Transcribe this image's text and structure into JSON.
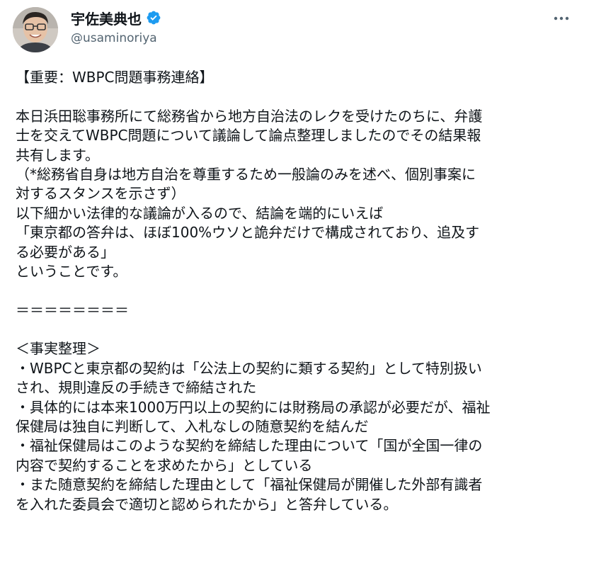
{
  "author": {
    "display_name": "宇佐美典也",
    "handle": "@usaminoriya",
    "verified": true,
    "avatar_icon": "person-avatar-icon"
  },
  "menu": {
    "icon": "more-horizontal-icon",
    "label": "···"
  },
  "colors": {
    "text": "#0f1419",
    "secondary_text": "#536471",
    "verified_badge": "#1d9bf0"
  },
  "tweet": {
    "lines": [
      "【重要：WBPC問題事務連絡】",
      "",
      "本日浜田聡事務所にて総務省から地方自治法のレクを受けたのちに、弁護",
      "士を交えてWBPC問題について議論して論点整理しましたのでその結果報",
      "共有します。",
      "（*総務省自身は地方自治を尊重するため一般論のみを述べ、個別事案に",
      "対するスタンスを示さず）",
      "以下細かい法律的な議論が入るので、結論を端的にいえば",
      "「東京都の答弁は、ほぼ100%ウソと詭弁だけで構成されており、追及す",
      "る必要がある」",
      "ということです。",
      "",
      "＝＝＝＝＝＝＝＝",
      "",
      "＜事実整理＞",
      "・WBPCと東京都の契約は「公法上の契約に類する契約」として特別扱い",
      "され、規則違反の手続きで締結された",
      "・具体的には本来1000万円以上の契約には財務局の承認が必要だが、福祉",
      "保健局は独自に判断して、入札なしの随意契約を結んだ",
      "・福祉保健局はこのような契約を締結した理由について「国が全国一律の",
      "内容で契約することを求めたから」としている",
      "・また随意契約を締結した理由として「福祉保健局が開催した外部有識者",
      "を入れた委員会で適切と認められたから」と答弁している。"
    ]
  }
}
